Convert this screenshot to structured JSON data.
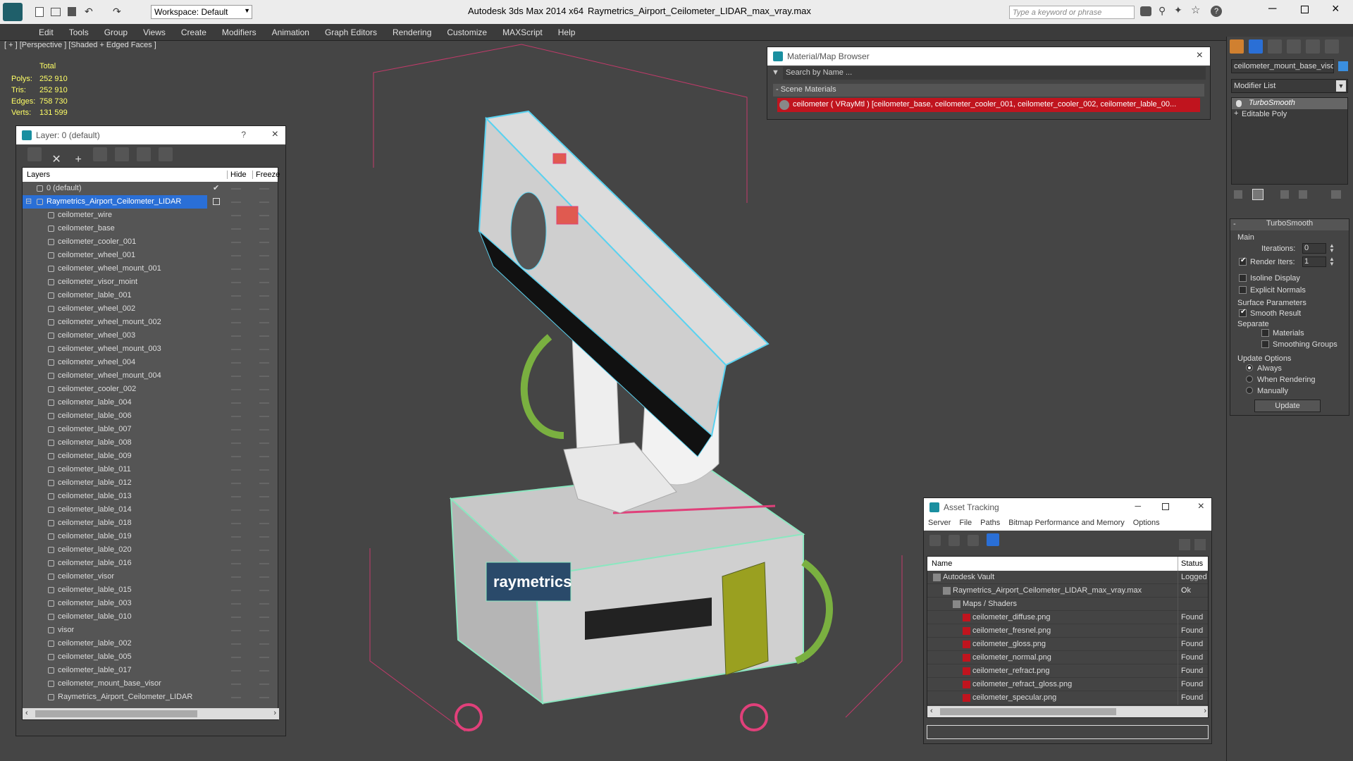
{
  "titlebar": {
    "workspace": "Workspace: Default",
    "app_title": "Autodesk 3ds Max  2014 x64",
    "file_title": "Raymetrics_Airport_Ceilometer_LIDAR_max_vray.max",
    "search_placeholder": "Type a keyword or phrase"
  },
  "menu": [
    "Edit",
    "Tools",
    "Group",
    "Views",
    "Create",
    "Modifiers",
    "Animation",
    "Graph Editors",
    "Rendering",
    "Customize",
    "MAXScript",
    "Help"
  ],
  "viewport": {
    "label": "[ + ] [Perspective ] [Shaded + Edged Faces ]",
    "stats_header": "Total",
    "stats": [
      {
        "label": "Polys:",
        "value": "252 910"
      },
      {
        "label": "Tris:",
        "value": "252 910"
      },
      {
        "label": "Edges:",
        "value": "758 730"
      },
      {
        "label": "Verts:",
        "value": "131 599"
      }
    ]
  },
  "layers": {
    "title": "Layer: 0 (default)",
    "help": "?",
    "col_layers": "Layers",
    "col_hide": "Hide",
    "col_freeze": "Freeze",
    "default_layer": "0 (default)",
    "selected_layer": "Raymetrics_Airport_Ceilometer_LIDAR",
    "items": [
      "ceilometer_wire",
      "ceilometer_base",
      "ceilometer_cooler_001",
      "ceilometer_wheel_001",
      "ceilometer_wheel_mount_001",
      "ceilometer_visor_moint",
      "ceilometer_lable_001",
      "ceilometer_wheel_002",
      "ceilometer_wheel_mount_002",
      "ceilometer_wheel_003",
      "ceilometer_wheel_mount_003",
      "ceilometer_wheel_004",
      "ceilometer_wheel_mount_004",
      "ceilometer_cooler_002",
      "ceilometer_lable_004",
      "ceilometer_lable_006",
      "ceilometer_lable_007",
      "ceilometer_lable_008",
      "ceilometer_lable_009",
      "ceilometer_lable_011",
      "ceilometer_lable_012",
      "ceilometer_lable_013",
      "ceilometer_lable_014",
      "ceilometer_lable_018",
      "ceilometer_lable_019",
      "ceilometer_lable_020",
      "ceilometer_lable_016",
      "ceilometer_visor",
      "ceilometer_lable_015",
      "ceilometer_lable_003",
      "ceilometer_lable_010",
      "visor",
      "ceilometer_lable_002",
      "ceilometer_lable_005",
      "ceilometer_lable_017",
      "ceilometer_mount_base_visor",
      "Raymetrics_Airport_Ceilometer_LIDAR"
    ]
  },
  "material_browser": {
    "title": "Material/Map Browser",
    "search_placeholder": "Search by Name ...",
    "section": "- Scene Materials",
    "material": "ceilometer ( VRayMtl ) [ceilometer_base, ceilometer_cooler_001, ceilometer_cooler_002, ceilometer_lable_00..."
  },
  "asset_tracking": {
    "title": "Asset Tracking",
    "menu": [
      "Server",
      "File",
      "Paths",
      "Bitmap Performance and Memory",
      "Options"
    ],
    "col_name": "Name",
    "col_status": "Status",
    "rows": [
      {
        "name": "Autodesk Vault",
        "status": "Logged C",
        "indent": 1
      },
      {
        "name": "Raymetrics_Airport_Ceilometer_LIDAR_max_vray.max",
        "status": "Ok",
        "indent": 2
      },
      {
        "name": "Maps / Shaders",
        "status": "",
        "indent": 3
      },
      {
        "name": "ceilometer_diffuse.png",
        "status": "Found",
        "indent": 4
      },
      {
        "name": "ceilometer_fresnel.png",
        "status": "Found",
        "indent": 4
      },
      {
        "name": "ceilometer_gloss.png",
        "status": "Found",
        "indent": 4
      },
      {
        "name": "ceilometer_normal.png",
        "status": "Found",
        "indent": 4
      },
      {
        "name": "ceilometer_refract.png",
        "status": "Found",
        "indent": 4
      },
      {
        "name": "ceilometer_refract_gloss.png",
        "status": "Found",
        "indent": 4
      },
      {
        "name": "ceilometer_specular.png",
        "status": "Found",
        "indent": 4
      }
    ]
  },
  "command_panel": {
    "object_name": "ceilometer_mount_base_visor",
    "modifier_list": "Modifier List",
    "stack": [
      "TurboSmooth",
      "Editable Poly"
    ],
    "rollout": "TurboSmooth",
    "main": "Main",
    "iterations_label": "Iterations:",
    "iterations": "0",
    "render_iters_label": "Render Iters:",
    "render_iters": "1",
    "isoline": "Isoline Display",
    "explicit": "Explicit Normals",
    "surface": "Surface Parameters",
    "smooth": "Smooth Result",
    "separate": "Separate",
    "materials": "Materials",
    "smoothing": "Smoothing Groups",
    "update_options": "Update Options",
    "always": "Always",
    "when_rendering": "When Rendering",
    "manually": "Manually",
    "update": "Update"
  },
  "colors": {
    "accent": "#1a8fa0",
    "wire_cyan": "#5ad2f0",
    "wire_green": "#8ce6c0",
    "wire_pink": "#e0407a",
    "selected": "#2a6fd6",
    "red": "#c0141e"
  }
}
